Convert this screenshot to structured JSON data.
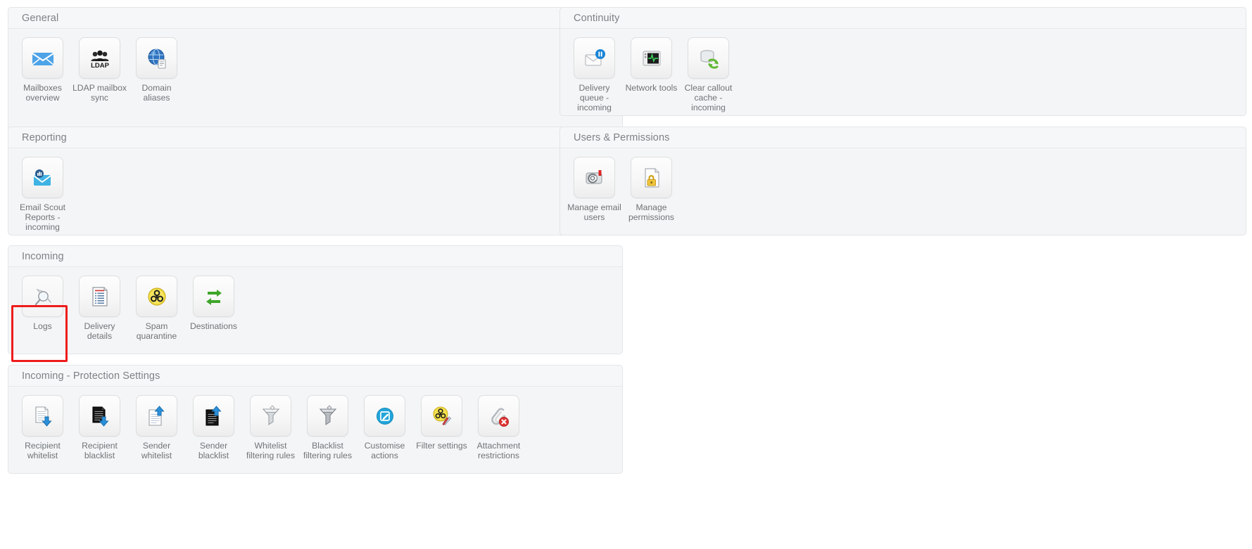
{
  "panels": [
    {
      "id": "general",
      "title": "General",
      "items": [
        {
          "label": "Mailboxes overview",
          "icon": "envelope-icon"
        },
        {
          "label": "LDAP mailbox sync",
          "icon": "ldap-users-icon"
        },
        {
          "label": "Domain aliases",
          "icon": "globe-document-icon"
        }
      ]
    },
    {
      "id": "continuity",
      "title": "Continuity",
      "items": [
        {
          "label": "Delivery queue - incoming",
          "icon": "envelope-pause-icon"
        },
        {
          "label": "Network tools",
          "icon": "network-monitor-icon"
        },
        {
          "label": "Clear callout cache - incoming",
          "icon": "database-refresh-icon"
        }
      ]
    },
    {
      "id": "reporting",
      "title": "Reporting",
      "items": [
        {
          "label": "Email Scout Reports - incoming",
          "icon": "envelope-chart-icon"
        }
      ]
    },
    {
      "id": "users-permissions",
      "title": "Users & Permissions",
      "items": [
        {
          "label": "Manage email users",
          "icon": "at-sign-tape-icon"
        },
        {
          "label": "Manage permissions",
          "icon": "lock-document-icon"
        }
      ]
    },
    {
      "id": "incoming",
      "title": "Incoming",
      "items": [
        {
          "label": "Logs",
          "icon": "magnifier-log-icon",
          "selected": true
        },
        {
          "label": "Delivery details",
          "icon": "list-document-icon"
        },
        {
          "label": "Spam quarantine",
          "icon": "biohazard-icon"
        },
        {
          "label": "Destinations",
          "icon": "green-arrows-icon"
        }
      ]
    },
    {
      "id": "incoming-protection-settings",
      "title": "Incoming - Protection Settings",
      "items": [
        {
          "label": "Recipient whitelist",
          "icon": "document-white-down-arrow-icon"
        },
        {
          "label": "Recipient blacklist",
          "icon": "document-black-down-arrow-icon"
        },
        {
          "label": "Sender whitelist",
          "icon": "document-white-up-arrow-icon"
        },
        {
          "label": "Sender blacklist",
          "icon": "document-black-up-arrow-icon"
        },
        {
          "label": "Whitelist filtering rules",
          "icon": "funnel-white-icon"
        },
        {
          "label": "Blacklist filtering rules",
          "icon": "funnel-grey-icon"
        },
        {
          "label": "Customise actions",
          "icon": "blue-pencil-circle-icon"
        },
        {
          "label": "Filter settings",
          "icon": "biohazard-tools-icon"
        },
        {
          "label": "Attachment restrictions",
          "icon": "paperclip-delete-icon"
        }
      ]
    }
  ],
  "colors": {
    "selection_ring": "#ee1c1c",
    "panel_bg": "#f4f5f6",
    "panel_header_bg": "#f6f7f8",
    "panel_border": "#e3e5e7",
    "title_text": "#7d8287",
    "label_text": "#6f7478"
  }
}
